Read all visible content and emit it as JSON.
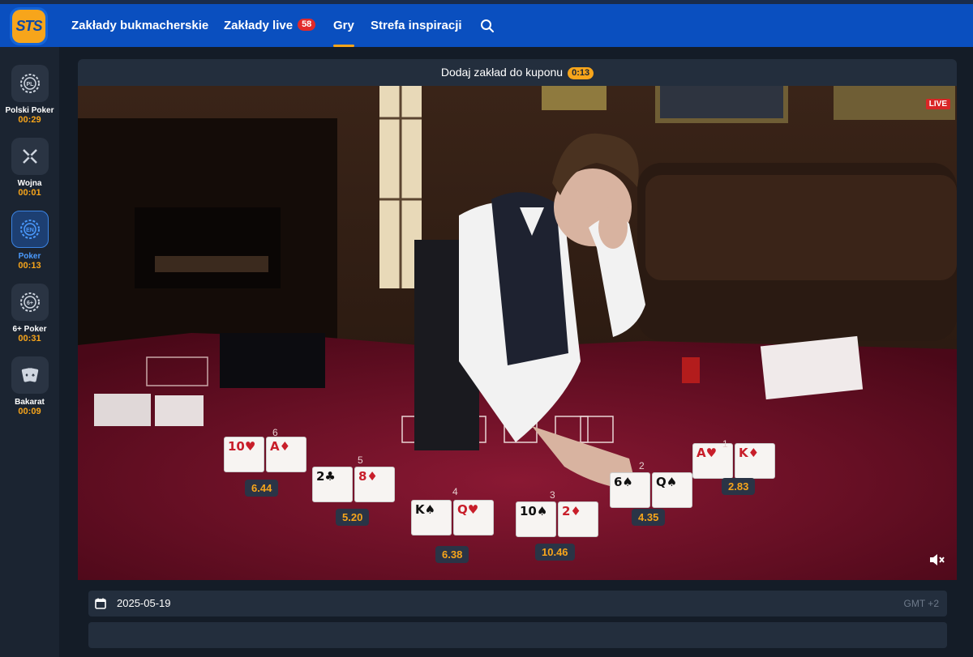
{
  "nav": {
    "logo": "STS",
    "items": [
      {
        "label": "Zakłady bukmacherskie"
      },
      {
        "label": "Zakłady live",
        "badge": "58"
      },
      {
        "label": "Gry",
        "active": true
      },
      {
        "label": "Strefa inspiracji"
      }
    ]
  },
  "sidebar": {
    "items": [
      {
        "label": "Polski Poker",
        "time": "00:29",
        "icon": "pl-chip-icon"
      },
      {
        "label": "Wojna",
        "time": "00:01",
        "icon": "crossed-swords-icon"
      },
      {
        "label": "Poker",
        "time": "00:13",
        "icon": "en-chip-icon",
        "active": true
      },
      {
        "label": "6+ Poker",
        "time": "00:31",
        "icon": "six-plus-chip-icon"
      },
      {
        "label": "Bakarat",
        "time": "00:09",
        "icon": "cards-icon"
      }
    ]
  },
  "coupon": {
    "text": "Dodaj zakład do kuponu",
    "timer": "0:13"
  },
  "video": {
    "live_label": "LIVE",
    "hands": [
      {
        "num": "1",
        "odds": "2.83",
        "cards": [
          "A♥",
          "K♦"
        ]
      },
      {
        "num": "2",
        "odds": "4.35",
        "cards": [
          "6♠",
          "Q♠"
        ]
      },
      {
        "num": "3",
        "odds": "10.46",
        "cards": [
          "10♠",
          "2♦"
        ]
      },
      {
        "num": "4",
        "odds": "6.38",
        "cards": [
          "K♠",
          "Q♥"
        ]
      },
      {
        "num": "5",
        "odds": "5.20",
        "cards": [
          "2♣",
          "8♦"
        ]
      },
      {
        "num": "6",
        "odds": "6.44",
        "cards": [
          "10♥",
          "A♦"
        ]
      }
    ]
  },
  "datebar": {
    "date": "2025-05-19",
    "timezone": "GMT +2"
  },
  "colors": {
    "accent": "#f7a51b",
    "nav_bg": "#0a4fbf",
    "panel": "#232e3d",
    "felt": "#6b0f24"
  }
}
